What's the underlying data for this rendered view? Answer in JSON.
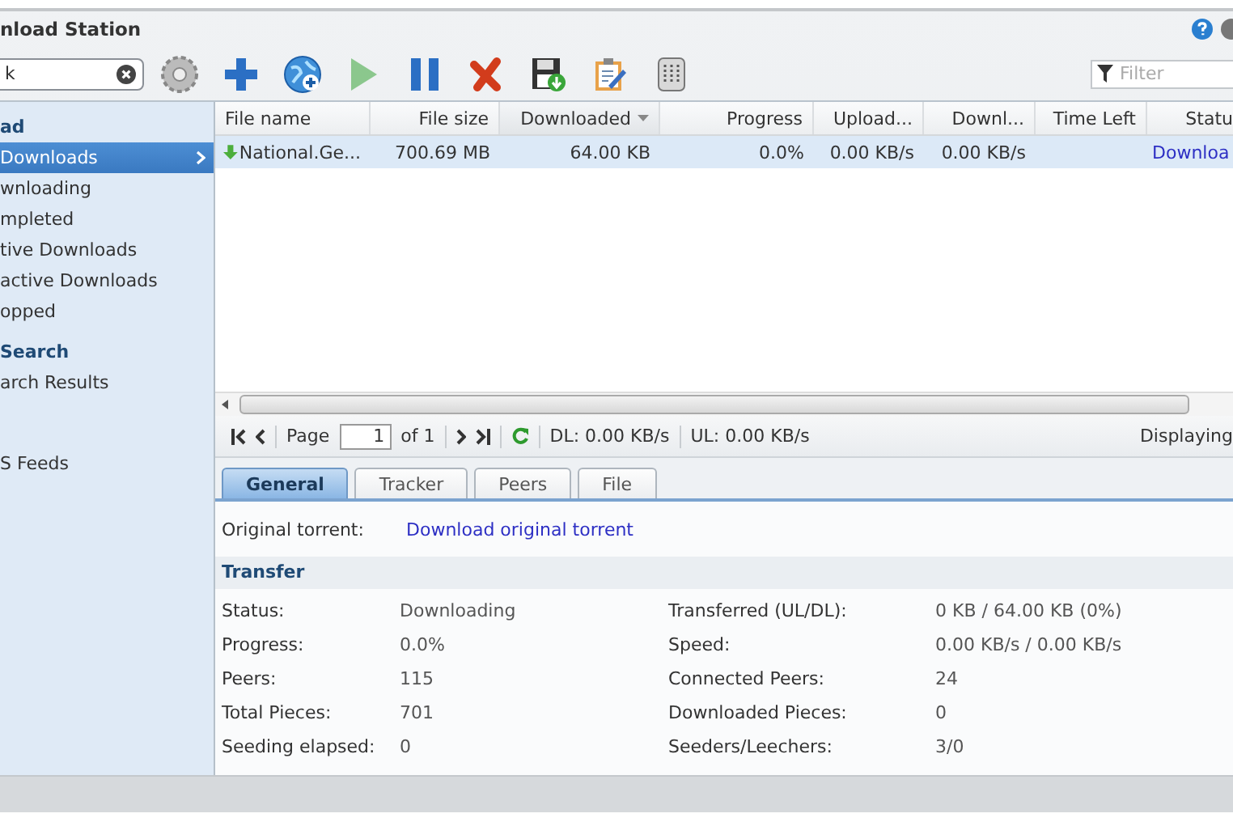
{
  "window": {
    "title": "nload Station"
  },
  "toolbar": {
    "search": {
      "value": "k"
    },
    "buttons": [
      {
        "kind": "settings",
        "disabled": false
      },
      {
        "kind": "add",
        "disabled": false
      },
      {
        "kind": "add-url",
        "disabled": false
      },
      {
        "kind": "resume",
        "disabled": true
      },
      {
        "kind": "pause",
        "disabled": false
      },
      {
        "kind": "delete",
        "disabled": false
      },
      {
        "kind": "save",
        "disabled": false
      },
      {
        "kind": "edit",
        "disabled": false
      },
      {
        "kind": "clear",
        "disabled": false
      }
    ],
    "filter": {
      "placeholder": "Filter"
    }
  },
  "sidebar": {
    "sections": [
      {
        "title": "ad",
        "items": [
          {
            "label": "Downloads",
            "selected": true
          },
          {
            "label": "wnloading",
            "selected": false
          },
          {
            "label": "mpleted",
            "selected": false
          },
          {
            "label": "tive Downloads",
            "selected": false
          },
          {
            "label": "active Downloads",
            "selected": false
          },
          {
            "label": "opped",
            "selected": false
          }
        ]
      },
      {
        "title": "Search",
        "items": [
          {
            "label": "arch Results",
            "selected": false
          }
        ]
      },
      {
        "items": [
          {
            "label": "S Feeds",
            "selected": false
          }
        ]
      }
    ]
  },
  "table": {
    "columns": [
      {
        "label": "File name",
        "sorted": false
      },
      {
        "label": "File size",
        "sorted": false
      },
      {
        "label": "Downloaded",
        "sorted": true
      },
      {
        "label": "Progress",
        "sorted": false
      },
      {
        "label": "Upload...",
        "sorted": false
      },
      {
        "label": "Downl...",
        "sorted": false
      },
      {
        "label": "Time Left",
        "sorted": false
      },
      {
        "label": "Statu",
        "sorted": false
      }
    ],
    "rows": [
      {
        "selected": true,
        "cells": [
          "National.Ge...",
          "700.69 MB",
          "64.00 KB",
          "0.0%",
          "0.00 KB/s",
          "0.00 KB/s",
          null,
          "Downloa"
        ]
      }
    ]
  },
  "pager": {
    "label": "Page",
    "page": "1",
    "of": "of 1",
    "dl": "DL: 0.00 KB/s",
    "ul": "UL: 0.00 KB/s",
    "displaying": "Displaying"
  },
  "details": {
    "tabs": [
      {
        "label": "General",
        "selected": true
      },
      {
        "label": "Tracker",
        "selected": false
      },
      {
        "label": "Peers",
        "selected": false
      },
      {
        "label": "File",
        "selected": false
      }
    ],
    "original_torrent": {
      "label": "Original torrent:",
      "link": "Download original torrent"
    },
    "section": "Transfer",
    "left_fields": [
      {
        "label": "Status:",
        "value": "Downloading"
      },
      {
        "label": "Progress:",
        "value": "0.0%"
      },
      {
        "label": "Peers:",
        "value": "115"
      },
      {
        "label": "Total Pieces:",
        "value": "701"
      },
      {
        "label": "Seeding elapsed:",
        "value": "0"
      }
    ],
    "right_fields": [
      {
        "label": "Transferred (UL/DL):",
        "value": "0 KB / 64.00 KB (0%)"
      },
      {
        "label": "Speed:",
        "value": "0.00 KB/s / 0.00 KB/s"
      },
      {
        "label": "Connected Peers:",
        "value": "24"
      },
      {
        "label": "Downloaded Pieces:",
        "value": "0"
      },
      {
        "label": "Seeders/Leechers:",
        "value": "3/0"
      }
    ]
  }
}
